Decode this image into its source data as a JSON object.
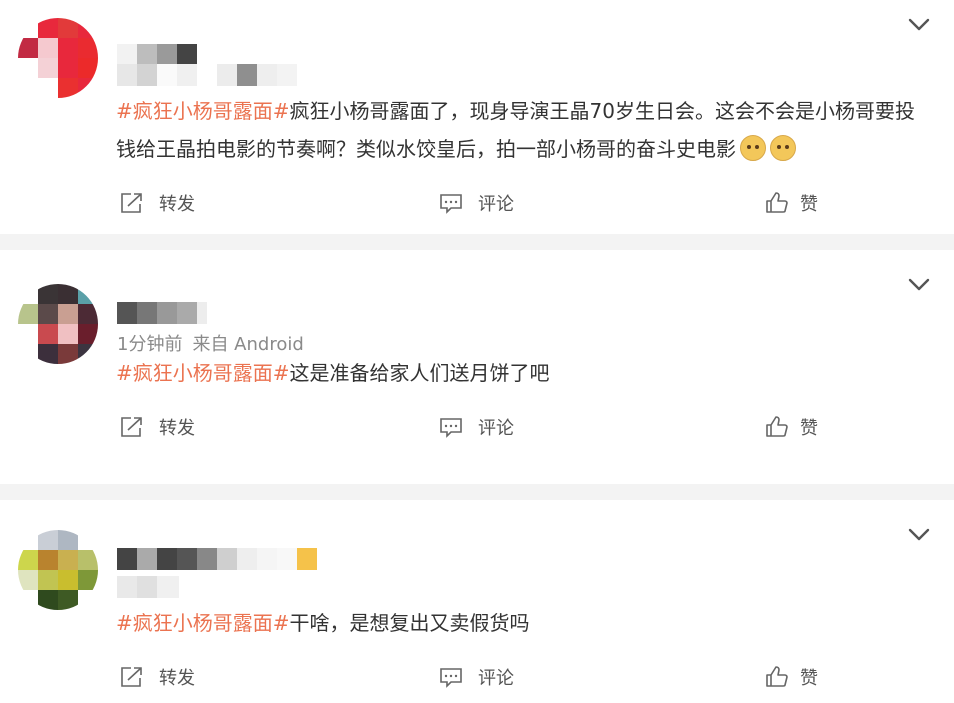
{
  "posts": [
    {
      "username": "",
      "time": "",
      "source": "",
      "hashtag": "#疯狂小杨哥露面#",
      "text": "疯狂小杨哥露面了，现身导演王晶70岁生日会。这会不会是小杨哥要投钱给王晶拍电影的节奏啊？类似水饺皇后，拍一部小杨哥的奋斗史电影",
      "emoji_count": 2,
      "actions": {
        "repost": "转发",
        "comment": "评论",
        "like": "赞"
      }
    },
    {
      "username": "",
      "time": "1分钟前",
      "source": "来自 Android",
      "hashtag": "#疯狂小杨哥露面#",
      "text": "这是准备给家人们送月饼了吧",
      "emoji_count": 0,
      "actions": {
        "repost": "转发",
        "comment": "评论",
        "like": "赞"
      }
    },
    {
      "username": "",
      "time": "",
      "source": "",
      "hashtag": "#疯狂小杨哥露面#",
      "text": "干啥，是想复出又卖假货吗",
      "emoji_count": 0,
      "actions": {
        "repost": "转发",
        "comment": "评论",
        "like": "赞"
      }
    }
  ],
  "colors": {
    "hashtag": "#eb7350",
    "meta": "#8a8a8a",
    "text": "#333333",
    "bg": "#f3f3f3"
  },
  "icons": [
    "chevron-down-icon",
    "repost-icon",
    "comment-icon",
    "like-icon",
    "dog-emoji-icon"
  ]
}
